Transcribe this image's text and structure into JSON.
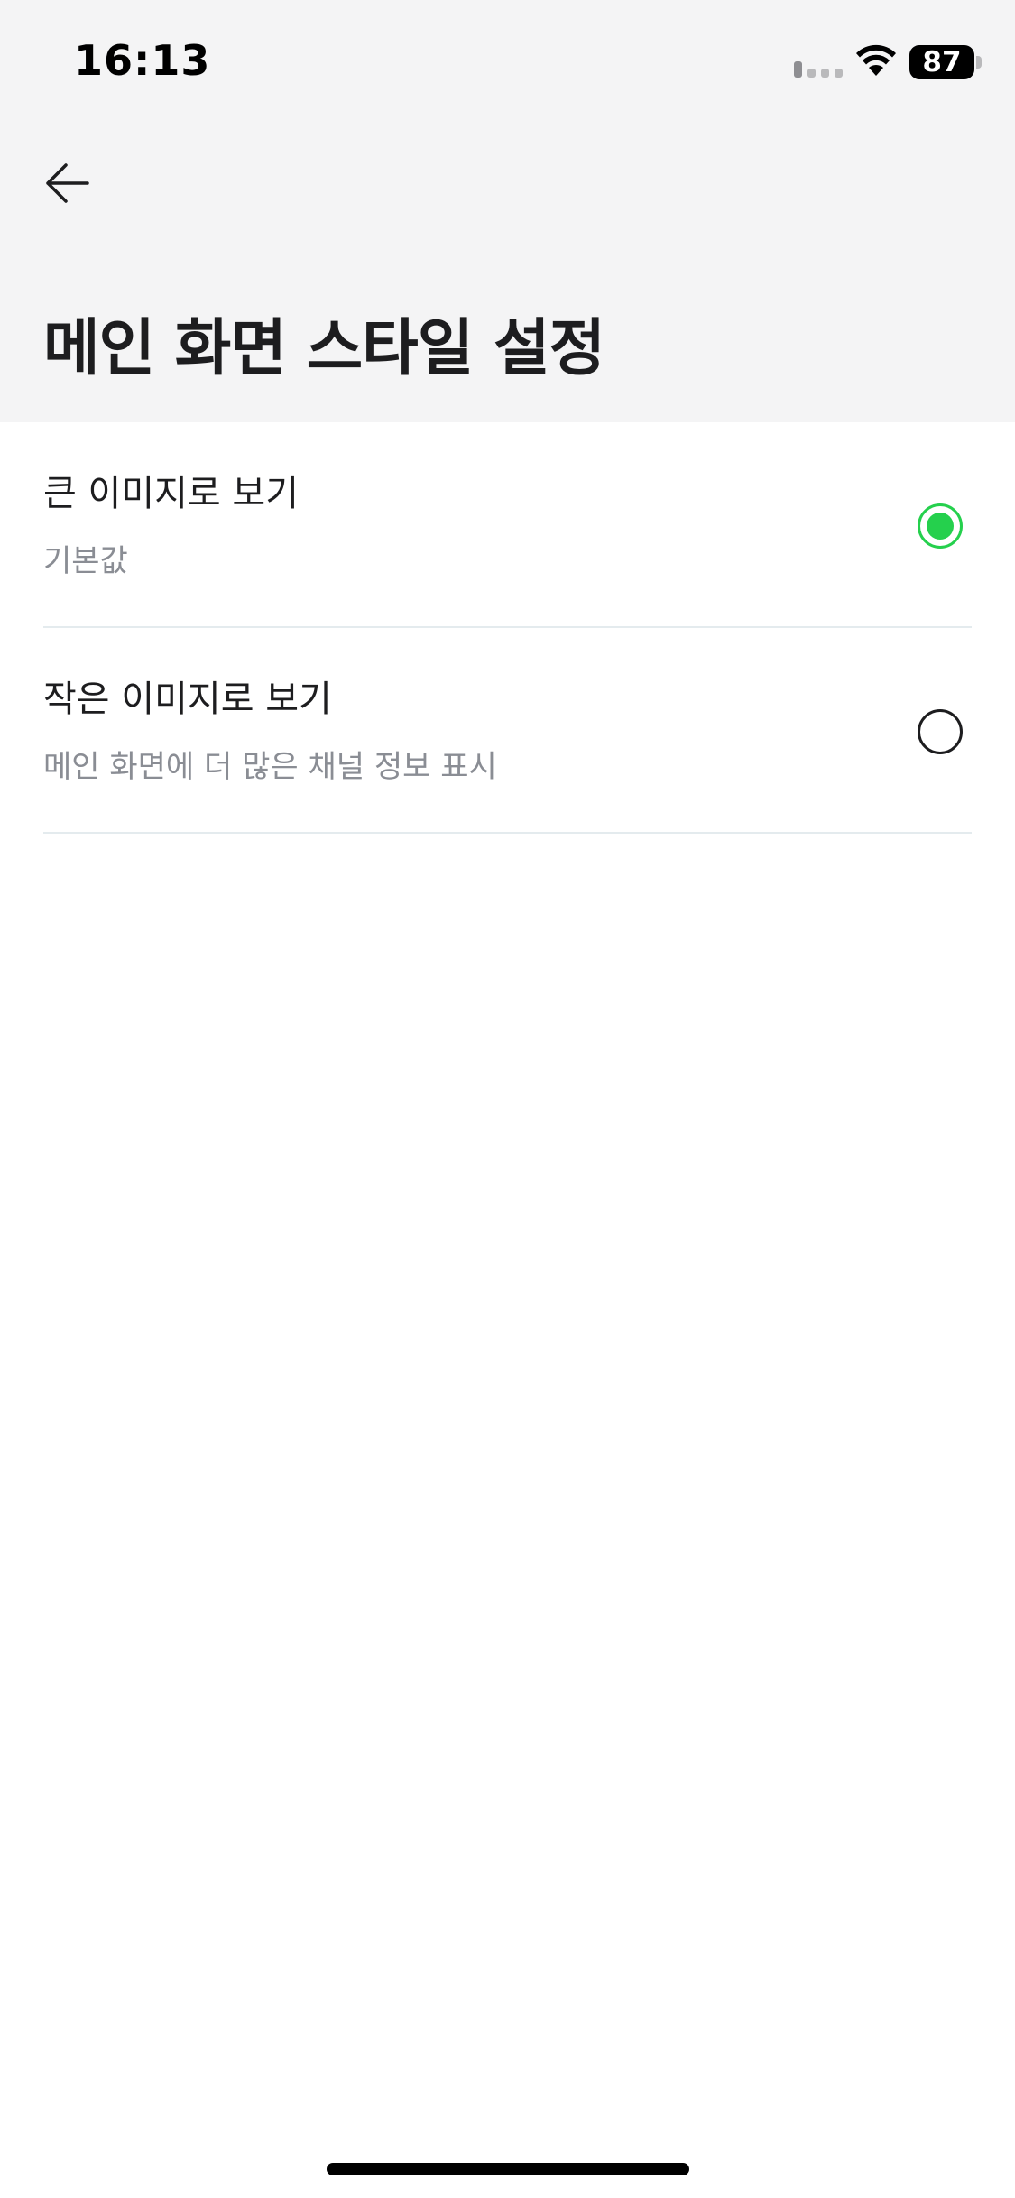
{
  "status_bar": {
    "time": "16:13",
    "battery": "87",
    "signal_icon": "cellular-signal-icon",
    "wifi_icon": "wifi-icon",
    "battery_icon": "battery-icon"
  },
  "header": {
    "back_icon": "arrow-left-icon",
    "title": "메인 화면 스타일 설정"
  },
  "options": [
    {
      "title": "큰 이미지로 보기",
      "subtitle": "기본값",
      "selected": true
    },
    {
      "title": "작은 이미지로 보기",
      "subtitle": "메인 화면에 더 많은 채널 정보 표시",
      "selected": false
    }
  ],
  "colors": {
    "accent": "#25d04d",
    "header_bg": "#f4f4f5",
    "divider": "#e4ebee",
    "subtitle": "#8a8d94"
  }
}
